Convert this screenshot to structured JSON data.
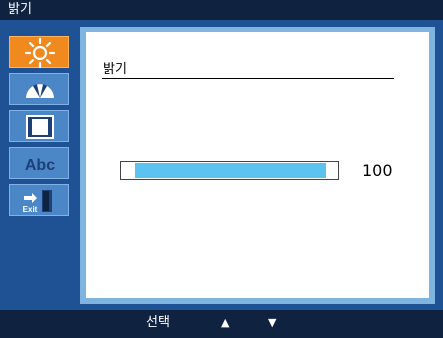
{
  "window": {
    "title": "밝기"
  },
  "sidebar": {
    "items": [
      {
        "icon": "sun-icon",
        "active": true
      },
      {
        "icon": "gauge-icon",
        "active": false
      },
      {
        "icon": "screen-frame-icon",
        "active": false
      },
      {
        "icon": "abc-text-icon",
        "label": "Abc",
        "active": false
      },
      {
        "icon": "exit-door-icon",
        "label": "Exit",
        "active": false
      }
    ]
  },
  "main": {
    "heading": "밝기",
    "slider": {
      "value": "100",
      "level_percent": 100
    }
  },
  "footer": {
    "select_label": "선택",
    "up_glyph": "▲",
    "down_glyph": "▼"
  },
  "colors": {
    "accent": "#f08a1e",
    "bar": "#0f2240",
    "frame": "#1f5294",
    "fill": "#5cc3f0"
  }
}
